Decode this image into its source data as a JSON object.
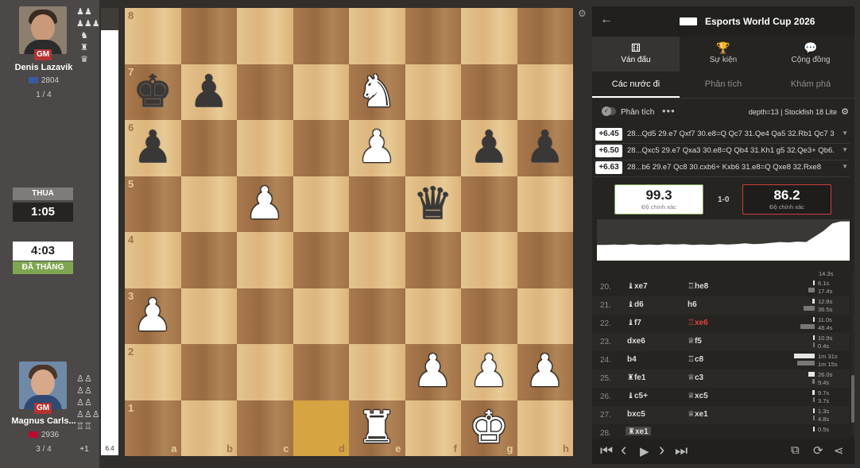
{
  "top_player": {
    "title_badge": "GM",
    "name": "Denis Lazavik",
    "rating": "2804",
    "score": "1 / 4",
    "flag_color": "#3b5aa3",
    "captured_icons": [
      "♟♟",
      "♟♟♟",
      "♞",
      "♜",
      "♛"
    ],
    "clock_status": "THUA",
    "clock_time": "1:05"
  },
  "bottom_player": {
    "title_badge": "GM",
    "name": "Magnus Carls...",
    "rating": "2936",
    "score": "3 / 4",
    "flag_color": "#ba0c2f",
    "captured_icons": [
      "♙♙",
      "♙♙",
      "♙♙",
      "♙♙♙",
      "♖♖"
    ],
    "material_diff": "+1",
    "clock_status": "ĐÃ THẮNG",
    "clock_time": "4:03"
  },
  "eval_bar": {
    "value": "6.4",
    "white_fraction": 0.95
  },
  "board": {
    "ranks": [
      "8",
      "7",
      "6",
      "5",
      "4",
      "3",
      "2",
      "1"
    ],
    "files": [
      "a",
      "b",
      "c",
      "d",
      "e",
      "f",
      "g",
      "h"
    ],
    "highlight_squares": [
      "d1",
      "e1"
    ],
    "pieces": [
      {
        "square": "a7",
        "piece": "♚",
        "color": "black"
      },
      {
        "square": "b7",
        "piece": "♟",
        "color": "black"
      },
      {
        "square": "e7",
        "piece": "♞",
        "color": "white"
      },
      {
        "square": "a6",
        "piece": "♟",
        "color": "black"
      },
      {
        "square": "e6",
        "piece": "♟",
        "color": "white"
      },
      {
        "square": "g6",
        "piece": "♟",
        "color": "black"
      },
      {
        "square": "h6",
        "piece": "♟",
        "color": "black"
      },
      {
        "square": "c5",
        "piece": "♟",
        "color": "white"
      },
      {
        "square": "f5",
        "piece": "♛",
        "color": "black"
      },
      {
        "square": "a3",
        "piece": "♟",
        "color": "white"
      },
      {
        "square": "f2",
        "piece": "♟",
        "color": "white"
      },
      {
        "square": "g2",
        "piece": "♟",
        "color": "white"
      },
      {
        "square": "h2",
        "piece": "♟",
        "color": "white"
      },
      {
        "square": "e1",
        "piece": "♜",
        "color": "white"
      },
      {
        "square": "g1",
        "piece": "♚",
        "color": "white"
      }
    ]
  },
  "right_panel": {
    "event_title": "Esports World Cup 2026",
    "tabs": [
      {
        "icon": "⚅",
        "label": "Ván đấu",
        "active": true
      },
      {
        "icon": "🏆",
        "label": "Sự kiện",
        "active": false
      },
      {
        "icon": "💬",
        "label": "Cộng đồng",
        "active": false
      }
    ],
    "sub_tabs": [
      {
        "label": "Các nước đi",
        "active": true
      },
      {
        "label": "Phân tích",
        "active": false
      },
      {
        "label": "Khám phá",
        "active": false
      }
    ],
    "analysis_label": "Phân tích",
    "engine_label": "depth=13 | Stockfish 18 Lite",
    "engine_lines": [
      {
        "eval": "+6.45",
        "moves": "28...Qd5 29.e7 Qxf7 30.e8=Q Qc7 31.Qe4 Qa5 32.Rb1 Qc7 3..."
      },
      {
        "eval": "+6.50",
        "moves": "28...Qxc5 29.e7 Qxa3 30.e8=Q Qb4 31.Kh1 g5 32.Qe3+ Qb6..."
      },
      {
        "eval": "+6.63",
        "moves": "28...b6 29.e7 Qc8 30.cxb6+ Kxb6 31.e8=Q Qxe8 32.Rxe8"
      }
    ],
    "accuracy": {
      "white": "99.3",
      "black": "86.2",
      "label": "Độ chính xác",
      "result": "1-0"
    },
    "graph_points": [
      0.62,
      0.62,
      0.61,
      0.62,
      0.6,
      0.62,
      0.61,
      0.62,
      0.6,
      0.61,
      0.6,
      0.62,
      0.61,
      0.62,
      0.6,
      0.61,
      0.6,
      0.58,
      0.6,
      0.59,
      0.57,
      0.55,
      0.56,
      0.54,
      0.55,
      0.42,
      0.28,
      0.1,
      0.05,
      0.05
    ],
    "partial_row": {
      "time": "14.3s"
    },
    "moves": [
      {
        "num": "20.",
        "white": "♝xe7",
        "black": "♖he8",
        "black_bad": false,
        "wt": "6.1s",
        "bt": "17.4s",
        "wbar": 0.05,
        "bbar": 0.3
      },
      {
        "num": "21.",
        "white": "♝d6",
        "black": "h6",
        "black_bad": false,
        "wt": "12.8s",
        "bt": "36.5s",
        "wbar": 0.1,
        "bbar": 0.55
      },
      {
        "num": "22.",
        "white": "♝f7",
        "black": "♖xe6",
        "black_bad": true,
        "wt": "11.0s",
        "bt": "48.4s",
        "wbar": 0.08,
        "bbar": 0.7
      },
      {
        "num": "23.",
        "white": "dxe6",
        "black": "♕f5",
        "black_bad": false,
        "wt": "10.9s",
        "bt": "0.4s",
        "wbar": 0.08,
        "bbar": 0.02
      },
      {
        "num": "24.",
        "white": "b4",
        "black": "♖c8",
        "black_bad": false,
        "wt": "1m 31s",
        "bt": "1m 15s",
        "wbar": 1.0,
        "bbar": 0.85
      },
      {
        "num": "25.",
        "white": "♜fe1",
        "black": "♕c3",
        "black_bad": false,
        "wt": "26.0s",
        "bt": "9.4s",
        "wbar": 0.3,
        "bbar": 0.1
      },
      {
        "num": "26.",
        "white": "♝c5+",
        "black": "♕xc5",
        "black_bad": false,
        "wt": "9.7s",
        "bt": "3.7s",
        "wbar": 0.1,
        "bbar": 0.04
      },
      {
        "num": "27.",
        "white": "bxc5",
        "black": "♕xe1",
        "black_bad": false,
        "wt": "1.3s",
        "bt": "4.8s",
        "wbar": 0.02,
        "bbar": 0.05
      },
      {
        "num": "28.",
        "white": "♜xe1",
        "black": "",
        "black_bad": false,
        "wt": "0.5s",
        "bt": "",
        "wbar": 0.01,
        "bbar": 0
      }
    ],
    "controls": [
      "⏮",
      "‹",
      "▶",
      "›",
      "⏭"
    ]
  }
}
